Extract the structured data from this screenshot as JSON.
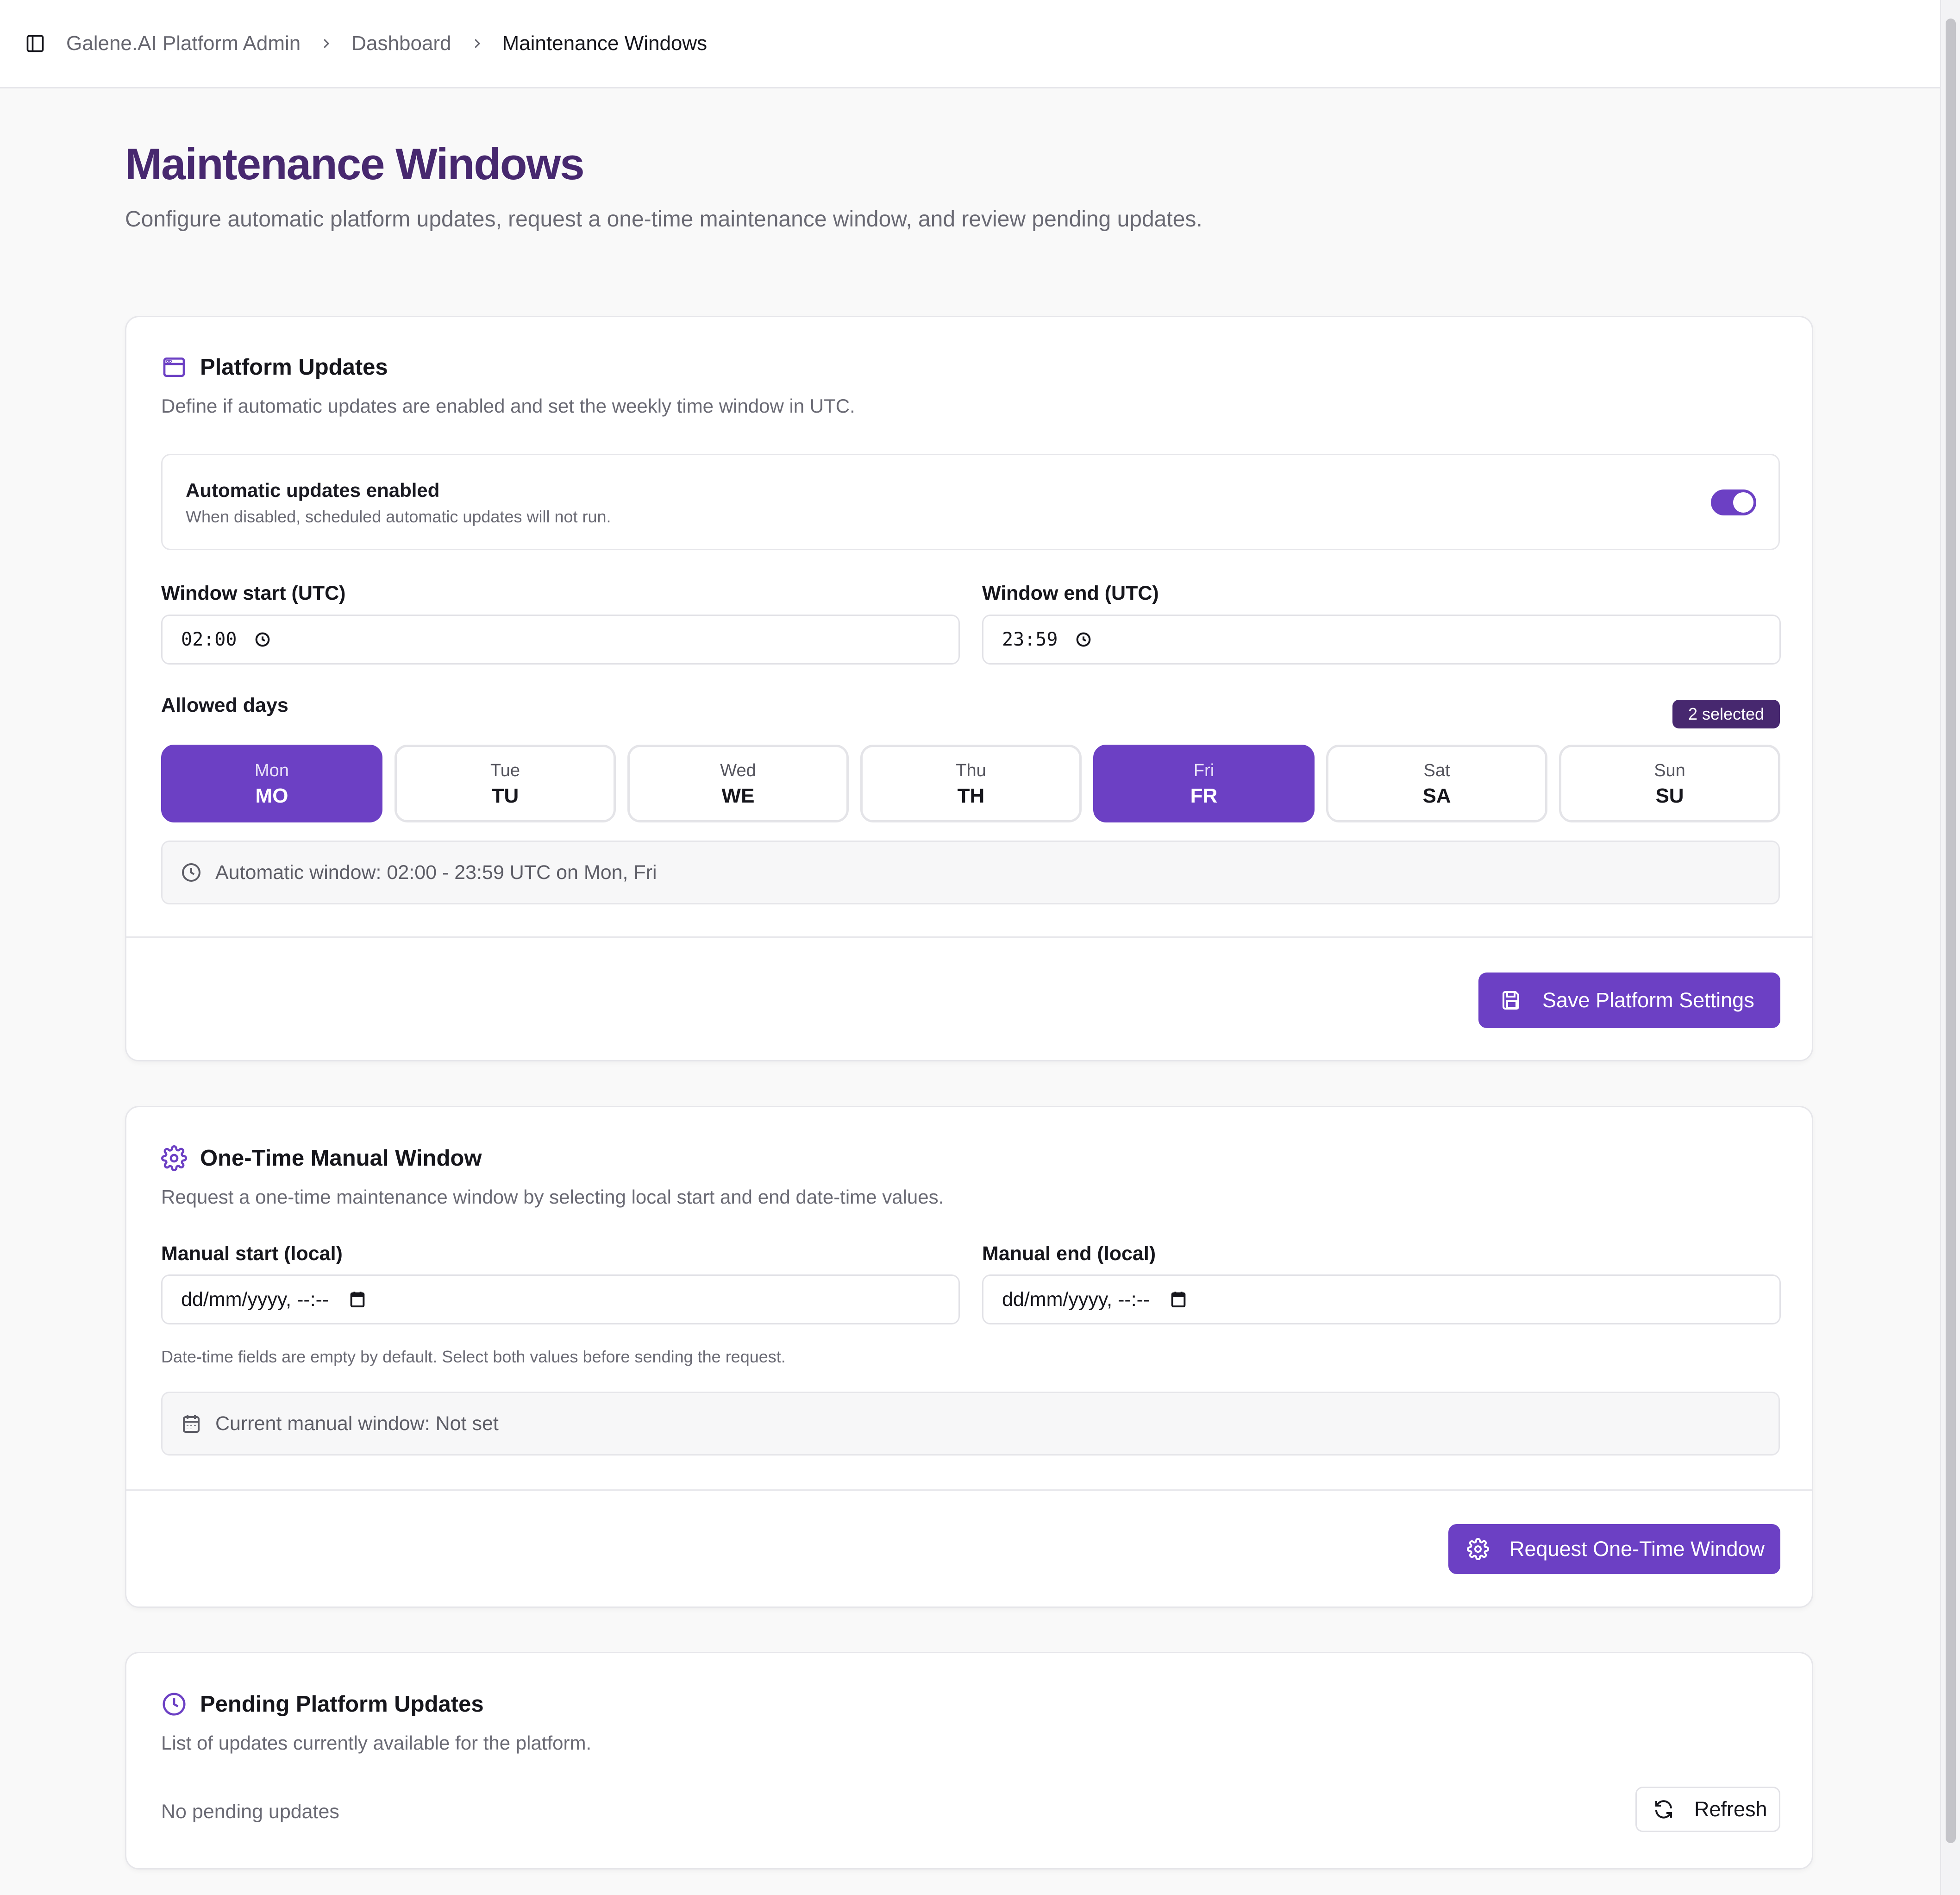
{
  "breadcrumb": {
    "items": [
      "Galene.AI Platform Admin",
      "Dashboard",
      "Maintenance Windows"
    ]
  },
  "page": {
    "title": "Maintenance Windows",
    "description": "Configure automatic platform updates, request a one-time maintenance window, and review pending updates."
  },
  "platform_updates": {
    "title": "Platform Updates",
    "description": "Define if automatic updates are enabled and set the weekly time window in UTC.",
    "toggle": {
      "title": "Automatic updates enabled",
      "subtitle": "When disabled, scheduled automatic updates will not run.",
      "enabled": true
    },
    "window_start": {
      "label": "Window start (UTC)",
      "value": "02:00"
    },
    "window_end": {
      "label": "Window end (UTC)",
      "value": "23:59"
    },
    "allowed_days_label": "Allowed days",
    "selected_badge": "2 selected",
    "days": [
      {
        "name": "Mon",
        "abbr": "MO",
        "selected": true
      },
      {
        "name": "Tue",
        "abbr": "TU",
        "selected": false
      },
      {
        "name": "Wed",
        "abbr": "WE",
        "selected": false
      },
      {
        "name": "Thu",
        "abbr": "TH",
        "selected": false
      },
      {
        "name": "Fri",
        "abbr": "FR",
        "selected": true
      },
      {
        "name": "Sat",
        "abbr": "SA",
        "selected": false
      },
      {
        "name": "Sun",
        "abbr": "SU",
        "selected": false
      }
    ],
    "summary": "Automatic window: 02:00 - 23:59 UTC on Mon, Fri",
    "save_button": "Save Platform Settings"
  },
  "manual_window": {
    "title": "One-Time Manual Window",
    "description": "Request a one-time maintenance window by selecting local start and end date-time values.",
    "start": {
      "label": "Manual start (local)",
      "placeholder": "dd/mm/yyyy, --:--"
    },
    "end": {
      "label": "Manual end (local)",
      "placeholder": "dd/mm/yyyy, --:--"
    },
    "hint": "Date-time fields are empty by default. Select both values before sending the request.",
    "current": "Current manual window: Not set",
    "request_button": "Request One-Time Window"
  },
  "pending": {
    "title": "Pending Platform Updates",
    "description": "List of updates currently available for the platform.",
    "empty_text": "No pending updates",
    "refresh_button": "Refresh"
  },
  "colors": {
    "accent": "#6c40c4",
    "title": "#47286f",
    "badge": "#47286f"
  }
}
